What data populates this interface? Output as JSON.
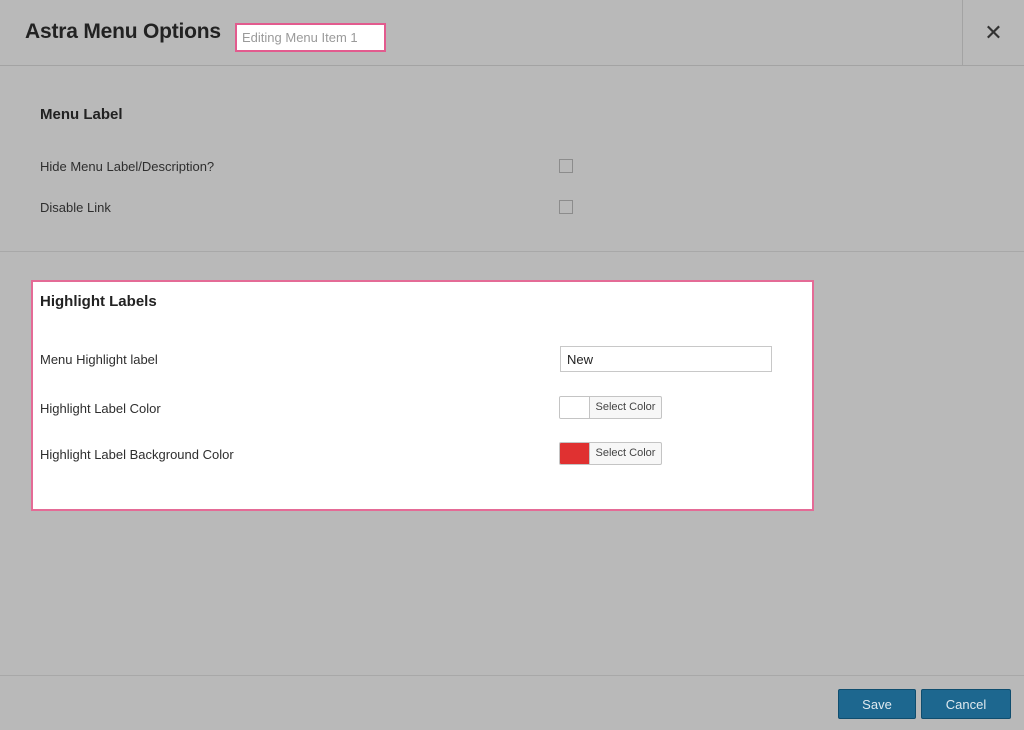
{
  "header": {
    "title": "Astra Menu Options",
    "subtitle": "Editing Menu Item 1",
    "close_icon": "close-icon",
    "close_glyph": "✕"
  },
  "menu_label": {
    "section_title": "Menu Label",
    "options": [
      {
        "label": "Hide Menu Label/Description?",
        "checked": false
      },
      {
        "label": "Disable Link",
        "checked": false
      }
    ]
  },
  "highlight_labels": {
    "section_title": "Highlight Labels",
    "menu_highlight_label": {
      "label": "Menu Highlight label",
      "value": "New"
    },
    "label_color": {
      "label": "Highlight Label Color",
      "button": "Select Color",
      "color": "#ffffff"
    },
    "label_bg_color": {
      "label": "Highlight Label Background Color",
      "button": "Select Color",
      "color": "#e03131"
    }
  },
  "footer": {
    "save_label": "Save",
    "cancel_label": "Cancel"
  },
  "colors": {
    "overlay_bg": "#b9b9b9",
    "highlight_border": "#e25b8e",
    "primary_button": "#1d678f"
  }
}
